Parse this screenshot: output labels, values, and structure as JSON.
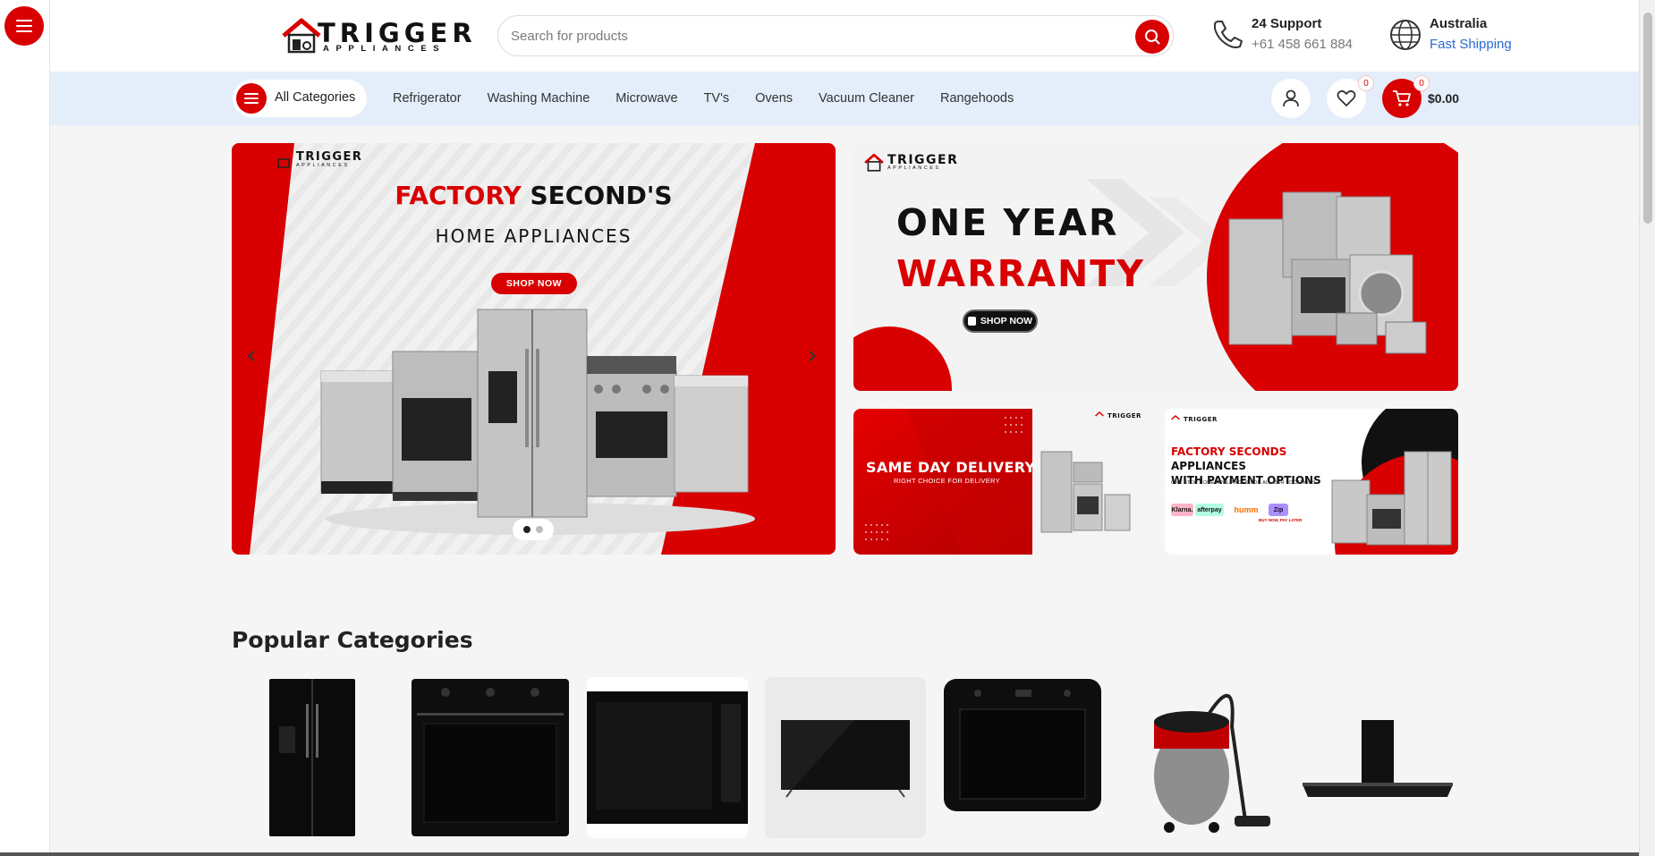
{
  "brand": {
    "name": "TRIGGER",
    "tagline": "APPLIANCES"
  },
  "search": {
    "placeholder": "Search for products"
  },
  "support": {
    "title": "24 Support",
    "phone": "+61 458 661 884"
  },
  "region": {
    "country": "Australia",
    "shipping": "Fast Shipping"
  },
  "nav": {
    "all_categories": "All Categories",
    "links": [
      "Refrigerator",
      "Washing Machine",
      "Microwave",
      "TV's",
      "Ovens",
      "Vacuum Cleaner",
      "Rangehoods"
    ],
    "wishlist_count": "0",
    "cart_count": "0",
    "cart_total": "$0.00"
  },
  "hero": {
    "title_red": "FACTORY",
    "title_black": "SECOND'S",
    "subtitle": "HOME APPLIANCES",
    "button": "SHOP NOW",
    "prev": "‹",
    "next": "›"
  },
  "warranty": {
    "line1": "ONE YEAR",
    "line2": "WARRANTY",
    "button": "SHOP NOW"
  },
  "same_day": {
    "title": "SAME DAY DELIVERY",
    "subtitle": "RIGHT CHOICE FOR DELIVERY"
  },
  "payment": {
    "title_red": "FACTORY SECONDS",
    "title_black_1": "APPLIANCES",
    "title_black_2": "WITH PAYMENT OPTIONS",
    "subtitle": "ONE STOP HOME APPLIANCES FOR ALL OUR LOCATIONS",
    "providers": [
      "Klarna.",
      "afterpay",
      "humm",
      "Zip"
    ],
    "note": "BUY NOW, PAY LATER"
  },
  "popular": {
    "title": "Popular Categories",
    "items": [
      "refrigerator",
      "oven",
      "microwave",
      "tv",
      "built-in-oven",
      "vacuum-cleaner",
      "rangehood"
    ]
  },
  "colors": {
    "accent": "#d80000",
    "nav_bg": "#e4eefb",
    "link": "#2a6ad3"
  }
}
